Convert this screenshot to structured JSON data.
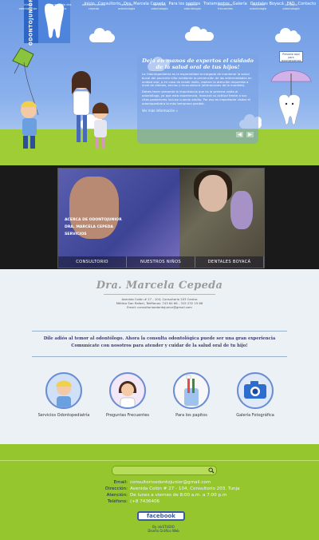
{
  "brand": {
    "name": "ODONTOJUNIOR"
  },
  "nav": [
    "Inicio",
    "Consultorio",
    "Dra. Marcela Cepeda",
    "Para los papitos",
    "Tratamientos",
    "Galería",
    "Dentales Boyacá",
    "FAQ",
    "Contacto"
  ],
  "hero": {
    "title": "Deja en manos de expertos el cuidado de la salud oral de tus hijos!",
    "paragraph1": "La Odontopediatría es la especialidad encargada de mantener la salud bucal del paciente niño mediante la prevención de las enfermedades en unidad oral, o en caso de existir daño, realizar la atención requerida a nivel de dientes, encías y musculatura (alteraciones de la mordida).",
    "paragraph2": "Debes tener presente la importancia que es la primera visita al odontólogo, ya que esta experiencia, marcará su actitud frente a sus citas posteriores incluso cuando adulto. Por eso es importante visitar el odontopediatra lo más temprano posible.",
    "more": "Ver más información »",
    "sign": "Presiona aquí para recomendarnos",
    "arrow_prev": "◀",
    "arrow_next": "▶"
  },
  "banner": {
    "menu": [
      "ACERCA DE ODONTOJUNIOR",
      "DRA. MARCELA CEPEDA",
      "SERVICIOS"
    ],
    "bar": [
      "CONSULTORIO",
      "NUESTROS NIÑOS",
      "DENTALES BOYACÁ"
    ]
  },
  "doctor": {
    "name": "Dra. Marcela Cepeda",
    "address1": "Avenida Colón # 27 - 104, Consultorio 203 Centro",
    "address2": "Médico San Rafael, Teléfonos: 743 64 66 - 315 232 19 66",
    "address3": "Email: consultorioodontojunior@gmail.com"
  },
  "message": {
    "line1": "Dile adiós al temor al odontólogo. Ahora la consulta odontológica puede ser una gran experiencia",
    "line2": "Comunícate con nosotros para atender y cuidar de la salud oral de tu hijo!"
  },
  "services": [
    {
      "label": "Servicios Odontopediatría",
      "icon": "boy-icon"
    },
    {
      "label": "Preguntas Frecuentes",
      "icon": "girl-icon"
    },
    {
      "label": "Para los papitos",
      "icon": "toothbrush-icon"
    },
    {
      "label": "Galería Fotográfica",
      "icon": "camera-icon"
    }
  ],
  "footer_menu": [
    "inicio odontojunior",
    "consultorio dra. marcela",
    "doctora marcela cepeda",
    "servicios odontología",
    "servicios odontología",
    "galería odontología",
    "preguntas frecuentes",
    "importes odontología",
    "contacto odontología"
  ],
  "contact": {
    "email_label": "Email:",
    "email": "consultorioodontojunior@gmail.com",
    "address_label": "Dirección:",
    "address": "Avenida Colón # 27 - 104, Consultorio 203. Tunja",
    "hours_label": "Atención:",
    "hours": "De lunes a viernes de 8:00 a.m. a 7:00 p.m",
    "phone_label": "Teléfono:",
    "phone": "(+8 7436406"
  },
  "social": {
    "facebook": "facebook"
  },
  "credit": {
    "by": "By inkSTUDIO",
    "sub": "Diseño Gráfico Web"
  }
}
